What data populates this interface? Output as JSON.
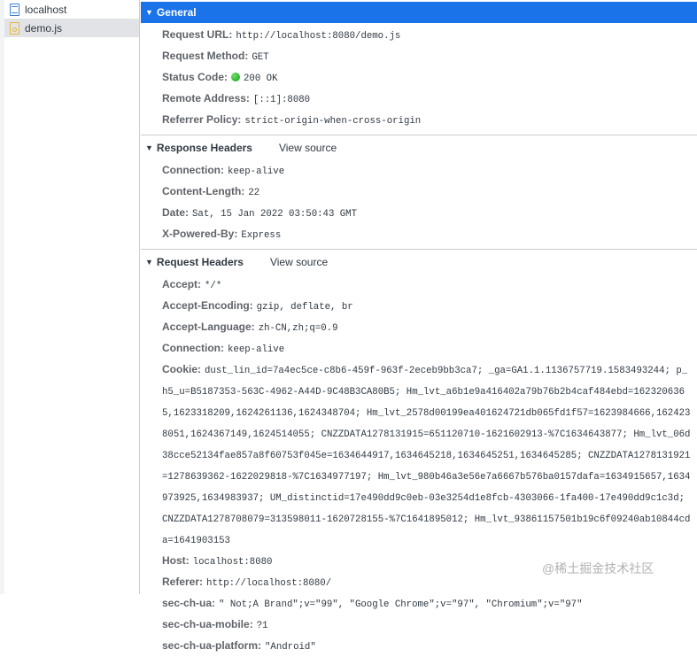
{
  "sidebar": {
    "files": [
      {
        "name": "localhost",
        "icon": "document-icon"
      },
      {
        "name": "demo.js",
        "icon": "script-file-icon"
      }
    ]
  },
  "general": {
    "title": "General",
    "rows": [
      {
        "key": "Request URL:",
        "value": "http://localhost:8080/demo.js"
      },
      {
        "key": "Request Method:",
        "value": "GET"
      },
      {
        "key": "Status Code:",
        "value": "200 OK"
      },
      {
        "key": "Remote Address:",
        "value": "[::1]:8080"
      },
      {
        "key": "Referrer Policy:",
        "value": "strict-origin-when-cross-origin"
      }
    ],
    "status_color": "#1aa31a"
  },
  "response": {
    "title": "Response Headers",
    "view_source": "View source",
    "rows": [
      {
        "key": "Connection:",
        "value": "keep-alive"
      },
      {
        "key": "Content-Length:",
        "value": "22"
      },
      {
        "key": "Date:",
        "value": "Sat, 15 Jan 2022 03:50:43 GMT"
      },
      {
        "key": "X-Powered-By:",
        "value": "Express"
      }
    ]
  },
  "request": {
    "title": "Request Headers",
    "view_source": "View source",
    "rows": [
      {
        "key": "Accept:",
        "value": "*/*"
      },
      {
        "key": "Accept-Encoding:",
        "value": "gzip, deflate, br"
      },
      {
        "key": "Accept-Language:",
        "value": "zh-CN,zh;q=0.9"
      },
      {
        "key": "Connection:",
        "value": "keep-alive"
      },
      {
        "key": "Cookie:",
        "value": "dust_lin_id=7a4ec5ce-c8b6-459f-963f-2eceb9bb3ca7; _ga=GA1.1.1136757719.1583493244; p_h5_u=B5187353-563C-4962-A44D-9C48B3CA80B5; Hm_lvt_a6b1e9a416402a79b76b2b4caf484ebd=1623206365,1623318209,1624261136,1624348704; Hm_lvt_2578d00199ea401624721db065fd1f57=1623984666,1624238051,1624367149,1624514055; CNZZDATA1278131915=651120710-1621602913-%7C1634643877; Hm_lvt_06d38cce52134fae857a8f60753f045e=1634644917,1634645218,1634645251,1634645285; CNZZDATA1278131921=1278639362-1622029818-%7C1634977197; Hm_lvt_980b46a3e56e7a6667b576ba0157dafa=1634915657,1634973925,1634983937; UM_distinctid=17e490dd9c0eb-03e3254d1e8fcb-4303066-1fa400-17e490dd9c1c3d; CNZZDATA1278708079=313598011-1620728155-%7C1641895012; Hm_lvt_93861157501b19c6f09240ab10844cda=1641903153"
      },
      {
        "key": "Host:",
        "value": "localhost:8080"
      },
      {
        "key": "Referer:",
        "value": "http://localhost:8080/"
      },
      {
        "key": "sec-ch-ua:",
        "value": "\" Not;A Brand\";v=\"99\", \"Google Chrome\";v=\"97\", \"Chromium\";v=\"97\""
      },
      {
        "key": "sec-ch-ua-mobile:",
        "value": "?1"
      },
      {
        "key": "sec-ch-ua-platform:",
        "value": "\"Android\""
      }
    ]
  },
  "watermark": "@稀土掘金技术社区"
}
